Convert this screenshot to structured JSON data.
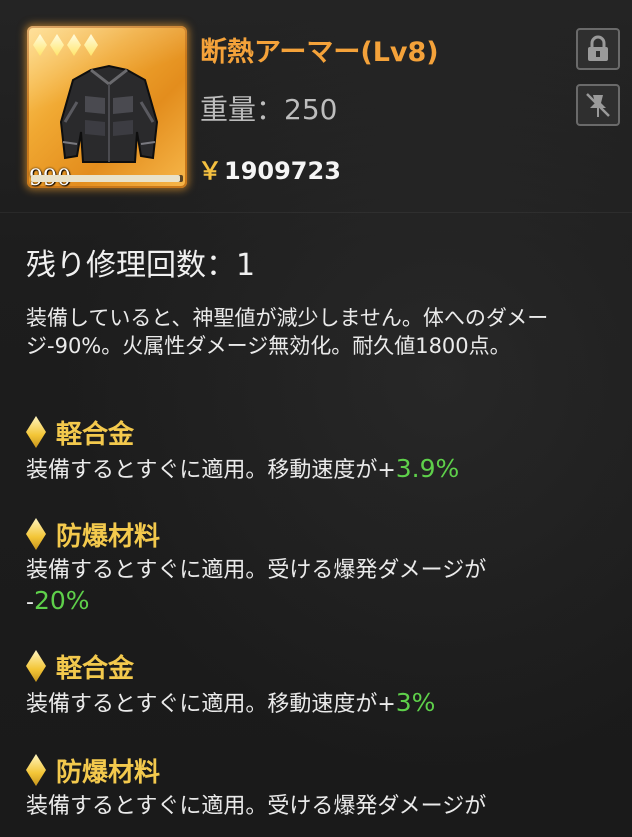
{
  "item": {
    "name": "断熱アーマー(Lv8)",
    "weight_label": "重量：",
    "weight_value": "250",
    "currency_symbol": "￥",
    "price": "1909723",
    "durability": "990",
    "rarity_diamonds": 4,
    "durability_fraction": 0.98,
    "icon": "armor-jacket-icon"
  },
  "buttons": {
    "lock_icon": "lock-icon",
    "pin_icon": "unpin-icon"
  },
  "repair": {
    "label": "残り修理回数：",
    "count": "1"
  },
  "description": "装備していると、神聖値が減少しません。体へのダメージ-90%。火属性ダメージ無効化。耐久値1800点。",
  "modules": [
    {
      "name": "軽合金",
      "text": "装備するとすぐに適用。移動速度が",
      "sign": "+",
      "value": "3.9%"
    },
    {
      "name": "防爆材料",
      "text": "装備するとすぐに適用。受ける爆発ダメージが",
      "sign": "-",
      "value": "20%"
    },
    {
      "name": "軽合金",
      "text": "装備するとすぐに適用。移動速度が",
      "sign": "+",
      "value": "3%"
    },
    {
      "name": "防爆材料",
      "text": "装備するとすぐに適用。受ける爆発ダメージが"
    }
  ],
  "colors": {
    "title": "#f4a23a",
    "module_name": "#f3c94d",
    "positive_value": "#5ed04a",
    "card_gold": "#f0a832"
  }
}
